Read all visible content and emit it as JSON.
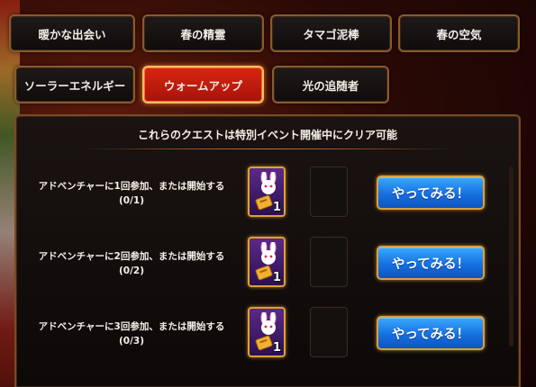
{
  "tabs": [
    {
      "label": "暖かな出会い",
      "active": false
    },
    {
      "label": "春の精霊",
      "active": false
    },
    {
      "label": "タマゴ泥棒",
      "active": false
    },
    {
      "label": "春の空気",
      "active": false
    },
    {
      "label": "ソーラーエネルギー",
      "active": false
    },
    {
      "label": "ウォームアップ",
      "active": true
    },
    {
      "label": "光の追随者",
      "active": false
    }
  ],
  "panel": {
    "title": "これらのクエストは特別イベント開催中にクリア可能"
  },
  "quests": [
    {
      "description": "アドベンチャーに1回参加、または開始する",
      "progress": "(0/1)",
      "reward_icon": "bunny-ticket-icon",
      "reward_count": "1",
      "button_label": "やってみる！"
    },
    {
      "description": "アドベンチャーに2回参加、または開始する",
      "progress": "(0/2)",
      "reward_icon": "bunny-ticket-icon",
      "reward_count": "1",
      "button_label": "やってみる！"
    },
    {
      "description": "アドベンチャーに3回参加、または開始する",
      "progress": "(0/3)",
      "reward_icon": "bunny-ticket-icon",
      "reward_count": "1",
      "button_label": "やってみる！"
    }
  ],
  "colors": {
    "active_tab": "#c8200e",
    "button_blue": "#1a78e8",
    "gold_border": "#e0a030"
  }
}
